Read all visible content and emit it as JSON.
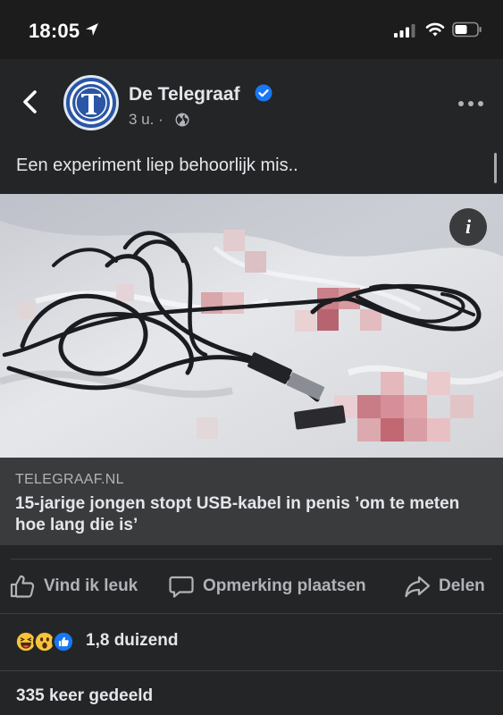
{
  "status_bar": {
    "time": "18:05"
  },
  "post": {
    "page_name": "De Telegraaf",
    "time_ago": "3 u.",
    "separator": "·",
    "text": "Een experiment liep behoorlijk mis..",
    "image_alt": "Zwarte USB-kabel op plastic met bloedvlekken (gepixeld)",
    "info_icon": "i",
    "link": {
      "domain": "TELEGRAAF.NL",
      "title": "15-jarige jongen stopt USB-kabel in penis ’om te meten hoe lang die is’"
    }
  },
  "actions": {
    "like": "Vind ik leuk",
    "comment": "Opmerking plaatsen",
    "share": "Delen"
  },
  "stats": {
    "reactions": "1,8 duizend",
    "shares": "335 keer gedeeld"
  },
  "colors": {
    "background": "#242526",
    "link_box": "#3a3b3c",
    "verified": "#1877f2",
    "muted": "#b0b3b8"
  },
  "icons": [
    "location-arrow-icon",
    "signal-icon",
    "wifi-icon",
    "battery-icon",
    "back-icon",
    "verified-icon",
    "globe-icon",
    "more-icon",
    "info-icon",
    "like-icon",
    "comment-icon",
    "share-icon",
    "haha-emoji-icon",
    "wow-emoji-icon",
    "like-emoji-icon"
  ]
}
